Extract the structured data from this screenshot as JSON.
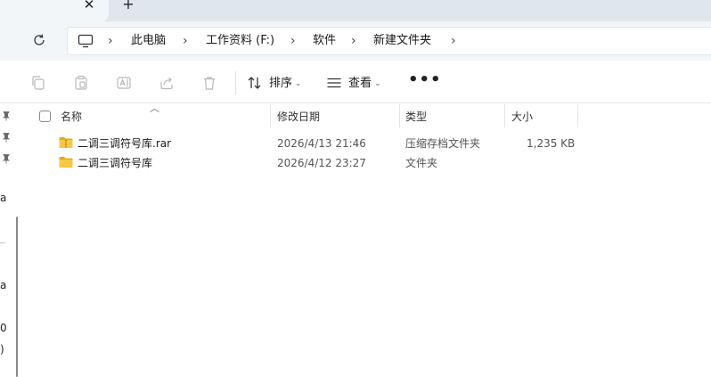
{
  "tabs": {
    "close_glyph": "✕",
    "new_glyph": "+"
  },
  "breadcrumb": {
    "items": [
      "此电脑",
      "工作资料 (F:)",
      "软件",
      "新建文件夹"
    ],
    "separator": "›"
  },
  "toolbar": {
    "sort_label": "排序",
    "view_label": "查看",
    "more_label": "•••",
    "caret": "⌄"
  },
  "columns": {
    "name": "名称",
    "modified": "修改日期",
    "type": "类型",
    "size": "大小"
  },
  "files": [
    {
      "name": "二调三调符号库.rar",
      "modified": "2026/4/13 21:46",
      "type": "压缩存档文件夹",
      "size": "1,235 KB",
      "icon": "archive-folder-icon"
    },
    {
      "name": "二调三调符号库",
      "modified": "2026/4/12 23:27",
      "type": "文件夹",
      "size": "",
      "icon": "folder-icon"
    }
  ],
  "left_pane": {
    "fragments": [
      "a",
      "a",
      "0",
      ")"
    ]
  },
  "colors": {
    "folder": "#f7c843",
    "folder_dark": "#e8a916",
    "tab_bar": "#dfe6ec",
    "address_row": "#f3f6f9"
  }
}
